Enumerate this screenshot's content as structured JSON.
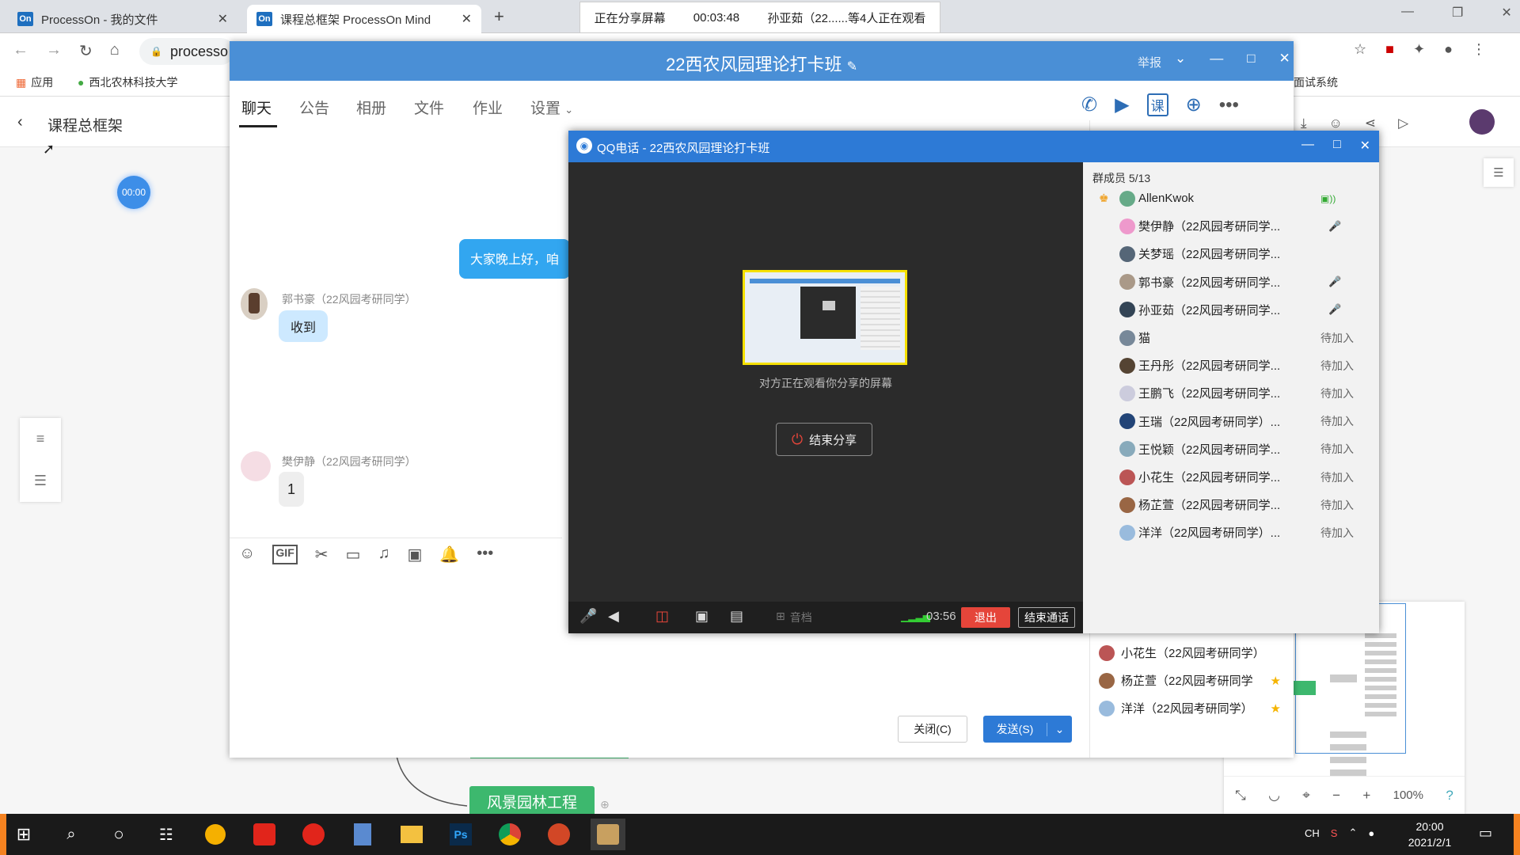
{
  "browser": {
    "tabs": [
      {
        "label": "ProcessOn - 我的文件",
        "favicon": "On"
      },
      {
        "label": "课程总框架 ProcessOn Mind",
        "favicon": "On"
      }
    ],
    "address": "processo",
    "bookmarks": [
      {
        "label": "应用"
      },
      {
        "label": "西北农林科技大学"
      }
    ],
    "bookmarks_right": "面试系统",
    "share_bar": {
      "status": "正在分享屏幕",
      "time": "00:03:48",
      "viewers": "孙亚茹（22......等4人正在观看"
    }
  },
  "processon": {
    "back_title": "课程总框架",
    "timer": "00:00",
    "node_label": "风景园林工程",
    "zoom": "100%"
  },
  "qq_group": {
    "title": "22西农风园理论打卡班",
    "report": "举报",
    "tabs": [
      "聊天",
      "公告",
      "相册",
      "文件",
      "作业",
      "设置"
    ],
    "course_btn": "课",
    "messages": [
      {
        "text": "大家晚上好，咱"
      },
      {
        "sender": "郭书豪（22风园考研同学）",
        "text": "收到"
      },
      {
        "sender": "樊伊静（22风园考研同学）",
        "text": "1"
      }
    ],
    "close_btn": "关闭(C)",
    "send_btn": "发送(S)",
    "member_list": [
      {
        "name": "小花生（22风园考研同学）"
      },
      {
        "name": "杨芷萱（22风园考研同学"
      },
      {
        "name": "洋洋（22风园考研同学）"
      }
    ]
  },
  "call": {
    "title": "QQ电话 - 22西农风园理论打卡班",
    "preview_text": "对方正在观看你分享的屏幕",
    "end_share": "结束分享",
    "members_header": "群成员 5/13",
    "members": [
      {
        "name": "AllenKwok",
        "status": "",
        "avatar": "#6a8"
      },
      {
        "name": "樊伊静（22风园考研同学...",
        "status": "",
        "avatar": "#e9c"
      },
      {
        "name": "关梦瑶（22风园考研同学...",
        "status": "",
        "avatar": "#567"
      },
      {
        "name": "郭书豪（22风园考研同学...",
        "status": "",
        "avatar": "#a98"
      },
      {
        "name": "孙亚茹（22风园考研同学...",
        "status": "",
        "avatar": "#345"
      },
      {
        "name": "猫",
        "status": "待加入",
        "avatar": "#789"
      },
      {
        "name": "王丹彤（22风园考研同学...",
        "status": "待加入",
        "avatar": "#543"
      },
      {
        "name": "王鹏飞（22风园考研同学...",
        "status": "待加入",
        "avatar": "#ccd"
      },
      {
        "name": "王瑞（22风园考研同学）...",
        "status": "待加入",
        "avatar": "#247"
      },
      {
        "name": "王悦颖（22风园考研同学...",
        "status": "待加入",
        "avatar": "#8ab"
      },
      {
        "name": "小花生（22风园考研同学...",
        "status": "待加入",
        "avatar": "#b55"
      },
      {
        "name": "杨芷萱（22风园考研同学...",
        "status": "待加入",
        "avatar": "#964"
      },
      {
        "name": "洋洋（22风园考研同学）...",
        "status": "待加入",
        "avatar": "#9bd"
      }
    ],
    "doc_label": "音档",
    "time": "03:56",
    "exit_btn": "退出",
    "end_call_btn": "结束通话"
  },
  "taskbar": {
    "time": "20:00",
    "date": "2021/2/1",
    "lang": "CH"
  }
}
